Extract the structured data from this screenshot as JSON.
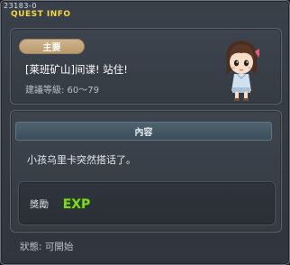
{
  "window": {
    "quest_id": "23183-0",
    "title": "QUEST INFO"
  },
  "quest": {
    "category": "主要",
    "name": "[莱班矿山]间谍! 站住!",
    "level_requirement": "建議等級: 60～79"
  },
  "npc": {
    "icon": "npc-girl-portrait"
  },
  "content": {
    "header": "內容",
    "text": "小孩乌里卡突然搭话了。"
  },
  "reward": {
    "label": "獎勵",
    "icon": "exp-icon",
    "icon_text": "EXP"
  },
  "status": {
    "text": "狀態: 可開始"
  },
  "colors": {
    "title": "#f3d64b",
    "badge": "#c5a87e",
    "exp_fill": "#7fd62a"
  }
}
